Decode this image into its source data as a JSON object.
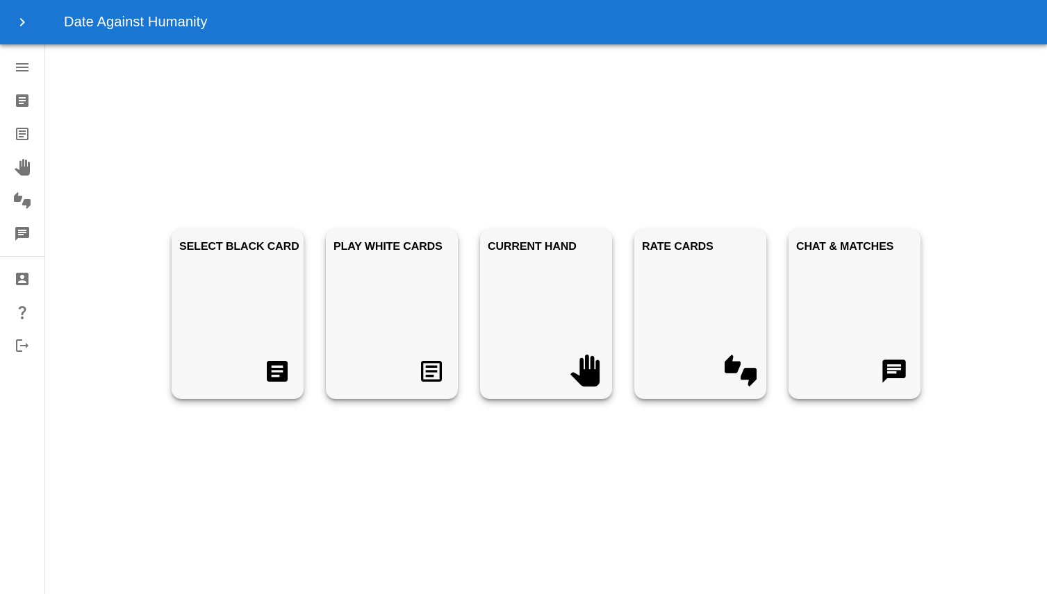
{
  "app": {
    "title": "Date Against Humanity",
    "accent_color": "#1976d2"
  },
  "toolbar": {
    "expand_icon": "chevron-right-icon"
  },
  "sidebar": {
    "items": [
      {
        "icon": "menu-icon"
      },
      {
        "icon": "black-card-icon"
      },
      {
        "icon": "white-card-icon"
      },
      {
        "icon": "hand-icon"
      },
      {
        "icon": "thumbs-up-down-icon"
      },
      {
        "icon": "chat-icon"
      }
    ],
    "secondary_items": [
      {
        "icon": "account-box-icon"
      },
      {
        "icon": "help-icon"
      },
      {
        "icon": "logout-icon"
      }
    ]
  },
  "cards": [
    {
      "label": "SELECT BLACK CARD",
      "icon": "black-card-icon"
    },
    {
      "label": "PLAY WHITE CARDS",
      "icon": "white-card-icon"
    },
    {
      "label": "CURRENT HAND",
      "icon": "hand-icon"
    },
    {
      "label": "RATE CARDS",
      "icon": "thumbs-up-down-icon"
    },
    {
      "label": "CHAT & MATCHES",
      "icon": "chat-icon"
    }
  ]
}
